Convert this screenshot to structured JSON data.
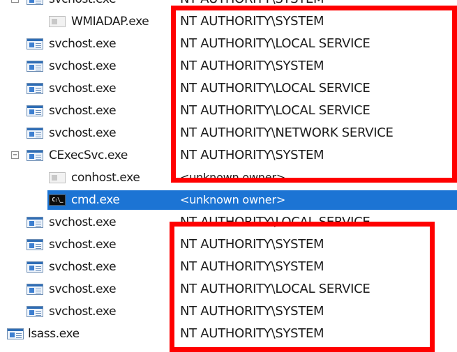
{
  "tree": {
    "rows": [
      {
        "name": "svchost.exe",
        "owner": "NT AUTHORITY\\SYSTEM",
        "icon": "app",
        "level": 0,
        "expander": "−",
        "selected": false
      },
      {
        "name": "WMIADAP.exe",
        "owner": "NT AUTHORITY\\SYSTEM",
        "icon": "console",
        "level": 1,
        "expander": "",
        "selected": false
      },
      {
        "name": "svchost.exe",
        "owner": "NT AUTHORITY\\LOCAL SERVICE",
        "icon": "app",
        "level": 0,
        "expander": "",
        "selected": false
      },
      {
        "name": "svchost.exe",
        "owner": "NT AUTHORITY\\SYSTEM",
        "icon": "app",
        "level": 0,
        "expander": "",
        "selected": false
      },
      {
        "name": "svchost.exe",
        "owner": "NT AUTHORITY\\LOCAL SERVICE",
        "icon": "app",
        "level": 0,
        "expander": "",
        "selected": false
      },
      {
        "name": "svchost.exe",
        "owner": "NT AUTHORITY\\LOCAL SERVICE",
        "icon": "app",
        "level": 0,
        "expander": "",
        "selected": false
      },
      {
        "name": "svchost.exe",
        "owner": "NT AUTHORITY\\NETWORK SERVICE",
        "icon": "app",
        "level": 0,
        "expander": "",
        "selected": false
      },
      {
        "name": "CExecSvc.exe",
        "owner": "NT AUTHORITY\\SYSTEM",
        "icon": "app",
        "level": 0,
        "expander": "−",
        "selected": false
      },
      {
        "name": "conhost.exe",
        "owner": "<unknown owner>",
        "icon": "console",
        "level": 1,
        "expander": "",
        "selected": false
      },
      {
        "name": "cmd.exe",
        "owner": "<unknown owner>",
        "icon": "cmd",
        "level": 1,
        "expander": "",
        "selected": true
      },
      {
        "name": "svchost.exe",
        "owner": "NT AUTHORITY\\LOCAL SERVICE",
        "icon": "app",
        "level": 0,
        "expander": "",
        "selected": false
      },
      {
        "name": "svchost.exe",
        "owner": "NT AUTHORITY\\SYSTEM",
        "icon": "app",
        "level": 0,
        "expander": "",
        "selected": false
      },
      {
        "name": "svchost.exe",
        "owner": "NT AUTHORITY\\SYSTEM",
        "icon": "app",
        "level": 0,
        "expander": "",
        "selected": false
      },
      {
        "name": "svchost.exe",
        "owner": "NT AUTHORITY\\LOCAL SERVICE",
        "icon": "app",
        "level": 0,
        "expander": "",
        "selected": false
      },
      {
        "name": "svchost.exe",
        "owner": "NT AUTHORITY\\SYSTEM",
        "icon": "app",
        "level": 0,
        "expander": "",
        "selected": false
      },
      {
        "name": "lsass.exe",
        "owner": "NT AUTHORITY\\SYSTEM",
        "icon": "app",
        "level": -1,
        "expander": "",
        "selected": false
      }
    ]
  },
  "colors": {
    "selection": "#1c74d4",
    "highlight_border": "#ff0000"
  }
}
